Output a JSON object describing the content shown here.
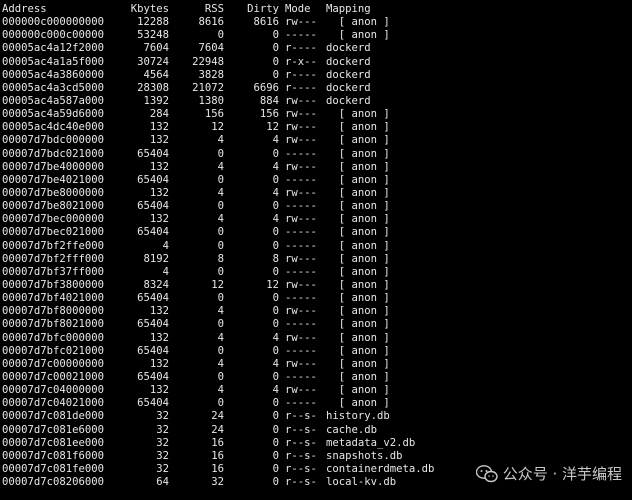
{
  "headers": {
    "address": "Address",
    "kbytes": "Kbytes",
    "rss": "RSS",
    "dirty": "Dirty",
    "mode": "Mode",
    "mapping": "Mapping"
  },
  "rows": [
    {
      "address": "000000c000000000",
      "kbytes": "12288",
      "rss": "8616",
      "dirty": "8616",
      "mode": "rw---",
      "mapping": "  [ anon ]"
    },
    {
      "address": "000000c000c00000",
      "kbytes": "53248",
      "rss": "0",
      "dirty": "0",
      "mode": "-----",
      "mapping": "  [ anon ]"
    },
    {
      "address": "00005ac4a12f2000",
      "kbytes": "7604",
      "rss": "7604",
      "dirty": "0",
      "mode": "r----",
      "mapping": "dockerd"
    },
    {
      "address": "00005ac4a1a5f000",
      "kbytes": "30724",
      "rss": "22948",
      "dirty": "0",
      "mode": "r-x--",
      "mapping": "dockerd"
    },
    {
      "address": "00005ac4a3860000",
      "kbytes": "4564",
      "rss": "3828",
      "dirty": "0",
      "mode": "r----",
      "mapping": "dockerd"
    },
    {
      "address": "00005ac4a3cd5000",
      "kbytes": "28308",
      "rss": "21072",
      "dirty": "6696",
      "mode": "r----",
      "mapping": "dockerd"
    },
    {
      "address": "00005ac4a587a000",
      "kbytes": "1392",
      "rss": "1380",
      "dirty": "884",
      "mode": "rw---",
      "mapping": "dockerd"
    },
    {
      "address": "00005ac4a59d6000",
      "kbytes": "284",
      "rss": "156",
      "dirty": "156",
      "mode": "rw---",
      "mapping": "  [ anon ]"
    },
    {
      "address": "00005ac4dc40e000",
      "kbytes": "132",
      "rss": "12",
      "dirty": "12",
      "mode": "rw---",
      "mapping": "  [ anon ]"
    },
    {
      "address": "00007d7bdc000000",
      "kbytes": "132",
      "rss": "4",
      "dirty": "4",
      "mode": "rw---",
      "mapping": "  [ anon ]"
    },
    {
      "address": "00007d7bdc021000",
      "kbytes": "65404",
      "rss": "0",
      "dirty": "0",
      "mode": "-----",
      "mapping": "  [ anon ]"
    },
    {
      "address": "00007d7be4000000",
      "kbytes": "132",
      "rss": "4",
      "dirty": "4",
      "mode": "rw---",
      "mapping": "  [ anon ]"
    },
    {
      "address": "00007d7be4021000",
      "kbytes": "65404",
      "rss": "0",
      "dirty": "0",
      "mode": "-----",
      "mapping": "  [ anon ]"
    },
    {
      "address": "00007d7be8000000",
      "kbytes": "132",
      "rss": "4",
      "dirty": "4",
      "mode": "rw---",
      "mapping": "  [ anon ]"
    },
    {
      "address": "00007d7be8021000",
      "kbytes": "65404",
      "rss": "0",
      "dirty": "0",
      "mode": "-----",
      "mapping": "  [ anon ]"
    },
    {
      "address": "00007d7bec000000",
      "kbytes": "132",
      "rss": "4",
      "dirty": "4",
      "mode": "rw---",
      "mapping": "  [ anon ]"
    },
    {
      "address": "00007d7bec021000",
      "kbytes": "65404",
      "rss": "0",
      "dirty": "0",
      "mode": "-----",
      "mapping": "  [ anon ]"
    },
    {
      "address": "00007d7bf2ffe000",
      "kbytes": "4",
      "rss": "0",
      "dirty": "0",
      "mode": "-----",
      "mapping": "  [ anon ]"
    },
    {
      "address": "00007d7bf2fff000",
      "kbytes": "8192",
      "rss": "8",
      "dirty": "8",
      "mode": "rw---",
      "mapping": "  [ anon ]"
    },
    {
      "address": "00007d7bf37ff000",
      "kbytes": "4",
      "rss": "0",
      "dirty": "0",
      "mode": "-----",
      "mapping": "  [ anon ]"
    },
    {
      "address": "00007d7bf3800000",
      "kbytes": "8324",
      "rss": "12",
      "dirty": "12",
      "mode": "rw---",
      "mapping": "  [ anon ]"
    },
    {
      "address": "00007d7bf4021000",
      "kbytes": "65404",
      "rss": "0",
      "dirty": "0",
      "mode": "-----",
      "mapping": "  [ anon ]"
    },
    {
      "address": "00007d7bf8000000",
      "kbytes": "132",
      "rss": "4",
      "dirty": "0",
      "mode": "rw---",
      "mapping": "  [ anon ]"
    },
    {
      "address": "00007d7bf8021000",
      "kbytes": "65404",
      "rss": "0",
      "dirty": "0",
      "mode": "-----",
      "mapping": "  [ anon ]"
    },
    {
      "address": "00007d7bfc000000",
      "kbytes": "132",
      "rss": "4",
      "dirty": "4",
      "mode": "rw---",
      "mapping": "  [ anon ]"
    },
    {
      "address": "00007d7bfc021000",
      "kbytes": "65404",
      "rss": "0",
      "dirty": "0",
      "mode": "-----",
      "mapping": "  [ anon ]"
    },
    {
      "address": "00007d7c00000000",
      "kbytes": "132",
      "rss": "4",
      "dirty": "4",
      "mode": "rw---",
      "mapping": "  [ anon ]"
    },
    {
      "address": "00007d7c00021000",
      "kbytes": "65404",
      "rss": "0",
      "dirty": "0",
      "mode": "-----",
      "mapping": "  [ anon ]"
    },
    {
      "address": "00007d7c04000000",
      "kbytes": "132",
      "rss": "4",
      "dirty": "4",
      "mode": "rw---",
      "mapping": "  [ anon ]"
    },
    {
      "address": "00007d7c04021000",
      "kbytes": "65404",
      "rss": "0",
      "dirty": "0",
      "mode": "-----",
      "mapping": "  [ anon ]"
    },
    {
      "address": "00007d7c081de000",
      "kbytes": "32",
      "rss": "24",
      "dirty": "0",
      "mode": "r--s-",
      "mapping": "history.db"
    },
    {
      "address": "00007d7c081e6000",
      "kbytes": "32",
      "rss": "24",
      "dirty": "0",
      "mode": "r--s-",
      "mapping": "cache.db"
    },
    {
      "address": "00007d7c081ee000",
      "kbytes": "32",
      "rss": "16",
      "dirty": "0",
      "mode": "r--s-",
      "mapping": "metadata_v2.db"
    },
    {
      "address": "00007d7c081f6000",
      "kbytes": "32",
      "rss": "16",
      "dirty": "0",
      "mode": "r--s-",
      "mapping": "snapshots.db"
    },
    {
      "address": "00007d7c081fe000",
      "kbytes": "32",
      "rss": "16",
      "dirty": "0",
      "mode": "r--s-",
      "mapping": "containerdmeta.db"
    },
    {
      "address": "00007d7c08206000",
      "kbytes": "64",
      "rss": "32",
      "dirty": "0",
      "mode": "r--s-",
      "mapping": "local-kv.db"
    }
  ],
  "watermark": {
    "text": "公众号 · 洋芋编程",
    "icon": "wechat-icon"
  }
}
